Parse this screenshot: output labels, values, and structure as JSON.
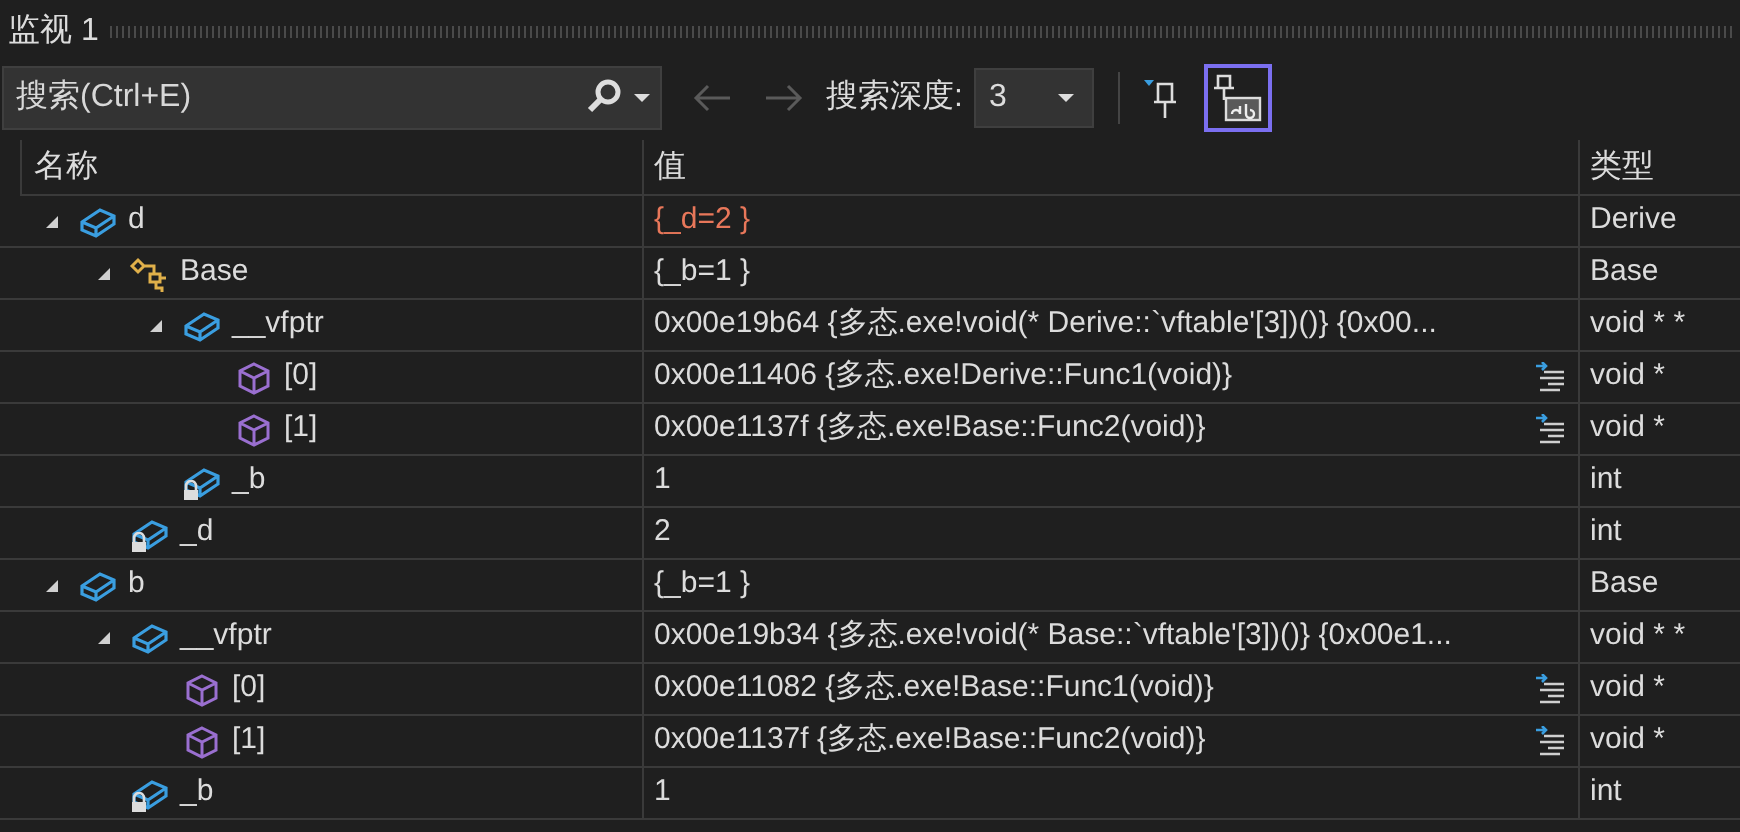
{
  "window": {
    "title": "监视 1"
  },
  "toolbar": {
    "search": {
      "placeholder": "搜索(Ctrl+E)"
    },
    "back_disabled": true,
    "forward_disabled": true,
    "depth_label": "搜索深度:",
    "depth_value": "3",
    "filter_pin_selected": false,
    "pin_ab_selected": true
  },
  "table": {
    "columns": [
      "名称",
      "值",
      "类型"
    ],
    "rows": [
      {
        "name": "d",
        "kind": "object",
        "expanded": true,
        "value": "{_d=2 }",
        "changed": true,
        "type": "Derive",
        "children": [
          {
            "name": "Base",
            "kind": "base",
            "expanded": true,
            "value": "{_b=1 }",
            "changed": false,
            "type": "Base",
            "children": [
              {
                "name": "__vfptr",
                "kind": "object",
                "expanded": true,
                "value": "0x00e19b64 {多态.exe!void(* Derive::`vftable'[3])()} {0x00...",
                "changed": false,
                "type": "void * *",
                "children": [
                  {
                    "name": "[0]",
                    "kind": "element",
                    "value": "0x00e11406 {多态.exe!Derive::Func1(void)}",
                    "visualizer": true,
                    "changed": false,
                    "type": "void *"
                  },
                  {
                    "name": "[1]",
                    "kind": "element",
                    "value": "0x00e1137f {多态.exe!Base::Func2(void)}",
                    "visualizer": true,
                    "changed": false,
                    "type": "void *"
                  }
                ]
              },
              {
                "name": "_b",
                "kind": "private",
                "value": "1",
                "changed": false,
                "type": "int"
              }
            ]
          },
          {
            "name": "_d",
            "kind": "private",
            "value": "2",
            "changed": false,
            "type": "int"
          }
        ]
      },
      {
        "name": "b",
        "kind": "object",
        "expanded": true,
        "value": "{_b=1 }",
        "changed": false,
        "type": "Base",
        "children": [
          {
            "name": "__vfptr",
            "kind": "object",
            "expanded": true,
            "value": "0x00e19b34 {多态.exe!void(* Base::`vftable'[3])()} {0x00e1...",
            "changed": false,
            "type": "void * *",
            "children": [
              {
                "name": "[0]",
                "kind": "element",
                "value": "0x00e11082 {多态.exe!Base::Func1(void)}",
                "visualizer": true,
                "changed": false,
                "type": "void *"
              },
              {
                "name": "[1]",
                "kind": "element",
                "value": "0x00e1137f {多态.exe!Base::Func2(void)}",
                "visualizer": true,
                "changed": false,
                "type": "void *"
              }
            ]
          },
          {
            "name": "_b",
            "kind": "private",
            "value": "1",
            "changed": false,
            "type": "int"
          }
        ]
      }
    ]
  }
}
